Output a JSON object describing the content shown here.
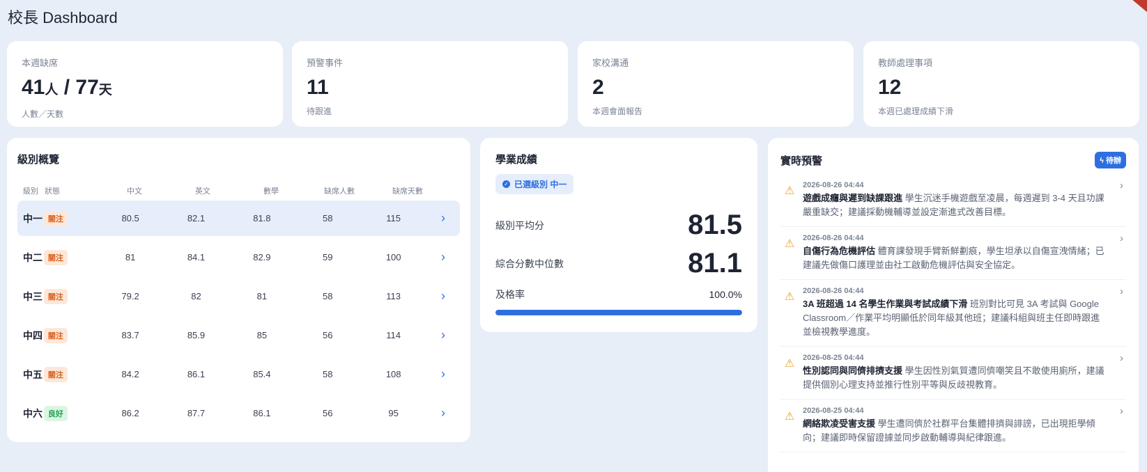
{
  "header": {
    "title": "校長 Dashboard"
  },
  "stats": [
    {
      "label": "本週缺席",
      "value": "41",
      "unit1": "人",
      "sep": " / ",
      "value2": "77",
      "unit2": "天",
      "sub": "人數／天數"
    },
    {
      "label": "預警事件",
      "value": "11",
      "sub": "待跟進"
    },
    {
      "label": "家校溝通",
      "value": "2",
      "sub": "本週會面報告"
    },
    {
      "label": "教師處理事項",
      "value": "12",
      "sub": "本週已處理成績下滑"
    }
  ],
  "grades": {
    "title": "級別概覽",
    "columns": [
      "級別",
      "狀態",
      "中文",
      "英文",
      "數學",
      "缺席人數",
      "缺席天數"
    ],
    "rows": [
      {
        "grade": "中一",
        "status": "關注",
        "chinese": "80.5",
        "english": "82.1",
        "math": "81.8",
        "absent_people": "58",
        "absent_days": "115"
      },
      {
        "grade": "中二",
        "status": "關注",
        "chinese": "81",
        "english": "84.1",
        "math": "82.9",
        "absent_people": "59",
        "absent_days": "100"
      },
      {
        "grade": "中三",
        "status": "關注",
        "chinese": "79.2",
        "english": "82",
        "math": "81",
        "absent_people": "58",
        "absent_days": "113"
      },
      {
        "grade": "中四",
        "status": "關注",
        "chinese": "83.7",
        "english": "85.9",
        "math": "85",
        "absent_people": "56",
        "absent_days": "114"
      },
      {
        "grade": "中五",
        "status": "關注",
        "chinese": "84.2",
        "english": "86.1",
        "math": "85.4",
        "absent_people": "58",
        "absent_days": "108"
      },
      {
        "grade": "中六",
        "status": "良好",
        "chinese": "86.2",
        "english": "87.7",
        "math": "86.1",
        "absent_people": "56",
        "absent_days": "95"
      }
    ]
  },
  "academic": {
    "title": "學業成績",
    "selected_chip": "已選級別 中一",
    "avg_label": "級別平均分",
    "avg_value": "81.5",
    "median_label": "綜合分數中位數",
    "median_value": "81.1",
    "pass_label": "及格率",
    "pass_value": "100.0%",
    "pass_fraction": 1.0
  },
  "alerts": {
    "title": "實時預警",
    "todo_label": "待辦",
    "items": [
      {
        "time": "2026-08-26 04:44",
        "title": "遊戲成癮與遲到缺課跟進",
        "text": " 學生沉迷手機遊戲至凌晨，每週遲到 3-4 天且功課嚴重缺交；建議採動機輔導並設定漸進式改善目標。"
      },
      {
        "time": "2026-08-26 04:44",
        "title": "自傷行為危機評估",
        "text": " 體育課發現手臂新鮮劃痕，學生坦承以自傷宣洩情緒；已建議先做傷口護理並由社工啟動危機評估與安全協定。"
      },
      {
        "time": "2026-08-26 04:44",
        "title": "3A 班超過 14 名學生作業與考試成績下滑",
        "text": " 班別對比可見 3A 考試與 Google Classroom／作業平均明顯低於同年級其他班；建議科組與班主任即時跟進並檢視教學進度。"
      },
      {
        "time": "2026-08-25 04:44",
        "title": "性別認同與同儕排擠支援",
        "text": " 學生因性別氣質遭同儕嘲笑且不敢使用廁所，建議提供個別心理支持並推行性別平等與反歧視教育。"
      },
      {
        "time": "2026-08-25 04:44",
        "title": "網絡欺凌受害支援",
        "text": " 學生遭同儕於社群平台集體排擠與誹謗，已出現拒學傾向；建議即時保留證據並同步啟動輔導與紀律跟進。"
      }
    ]
  },
  "colors": {
    "accent": "#2d6fe0",
    "warn": "#d9611c",
    "good": "#23a04d",
    "alert": "#f0a020"
  },
  "icons": {
    "alert": "warning-triangle-icon",
    "row_arrow": "chevron-right-icon",
    "chip": "check-circle-icon",
    "todo": "bolt-icon"
  }
}
